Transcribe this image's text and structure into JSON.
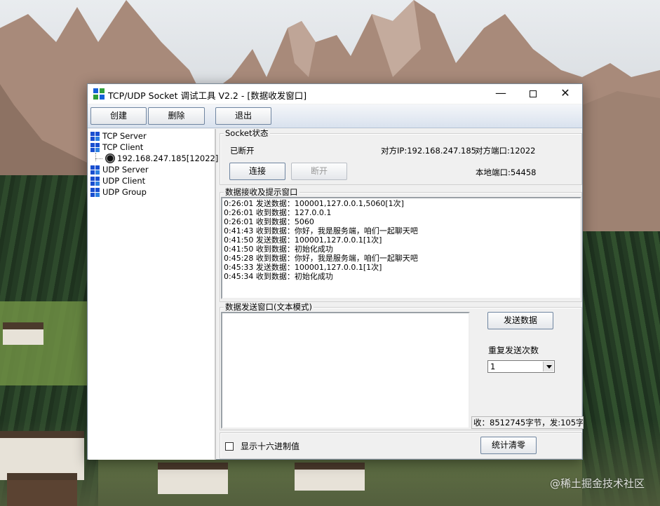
{
  "window": {
    "title": "TCP/UDP Socket 调试工具 V2.2 - [数据收发窗口]",
    "min_glyph": "—",
    "close_glyph": "✕"
  },
  "toolbar": {
    "create_label": "创建",
    "delete_label": "删除",
    "exit_label": "退出"
  },
  "tree": {
    "items": [
      {
        "label": "TCP Server"
      },
      {
        "label": "TCP Client"
      },
      {
        "label": "192.168.247.185[12022]"
      },
      {
        "label": "UDP Server"
      },
      {
        "label": "UDP Client"
      },
      {
        "label": "UDP Group"
      }
    ]
  },
  "socket_status": {
    "group_title": "Socket状态",
    "state": "已断开",
    "remote_ip": "对方IP:192.168.247.185",
    "remote_port": "对方端口:12022",
    "connect_label": "连接",
    "disconnect_label": "断开",
    "local_port": "本地端口:54458"
  },
  "receive": {
    "group_title": "数据接收及提示窗口",
    "lines": [
      "0:26:01 发送数据：100001,127.0.0.1,5060[1次]",
      "0:26:01 收到数据：127.0.0.1",
      "0:26:01 收到数据：5060",
      "0:41:43 收到数据：你好，我是服务端，咱们一起聊天吧",
      "0:41:50 发送数据：100001,127.0.0.1[1次]",
      "0:41:50 收到数据：初始化成功",
      "0:45:28 收到数据：你好，我是服务端，咱们一起聊天吧",
      "0:45:33 发送数据：100001,127.0.0.1[1次]",
      "0:45:34 收到数据：初始化成功"
    ]
  },
  "send": {
    "group_title": "数据发送窗口(文本模式)",
    "text": "",
    "send_button_label": "发送数据",
    "repeat_label": "重复发送次数",
    "repeat_value": "1",
    "status_text": "收：8512745字节，发:105字",
    "hex_label": "显示十六进制值",
    "clear_stats_label": "统计清零"
  },
  "desktop": {
    "watermark": "@稀土掘金技术社区"
  }
}
